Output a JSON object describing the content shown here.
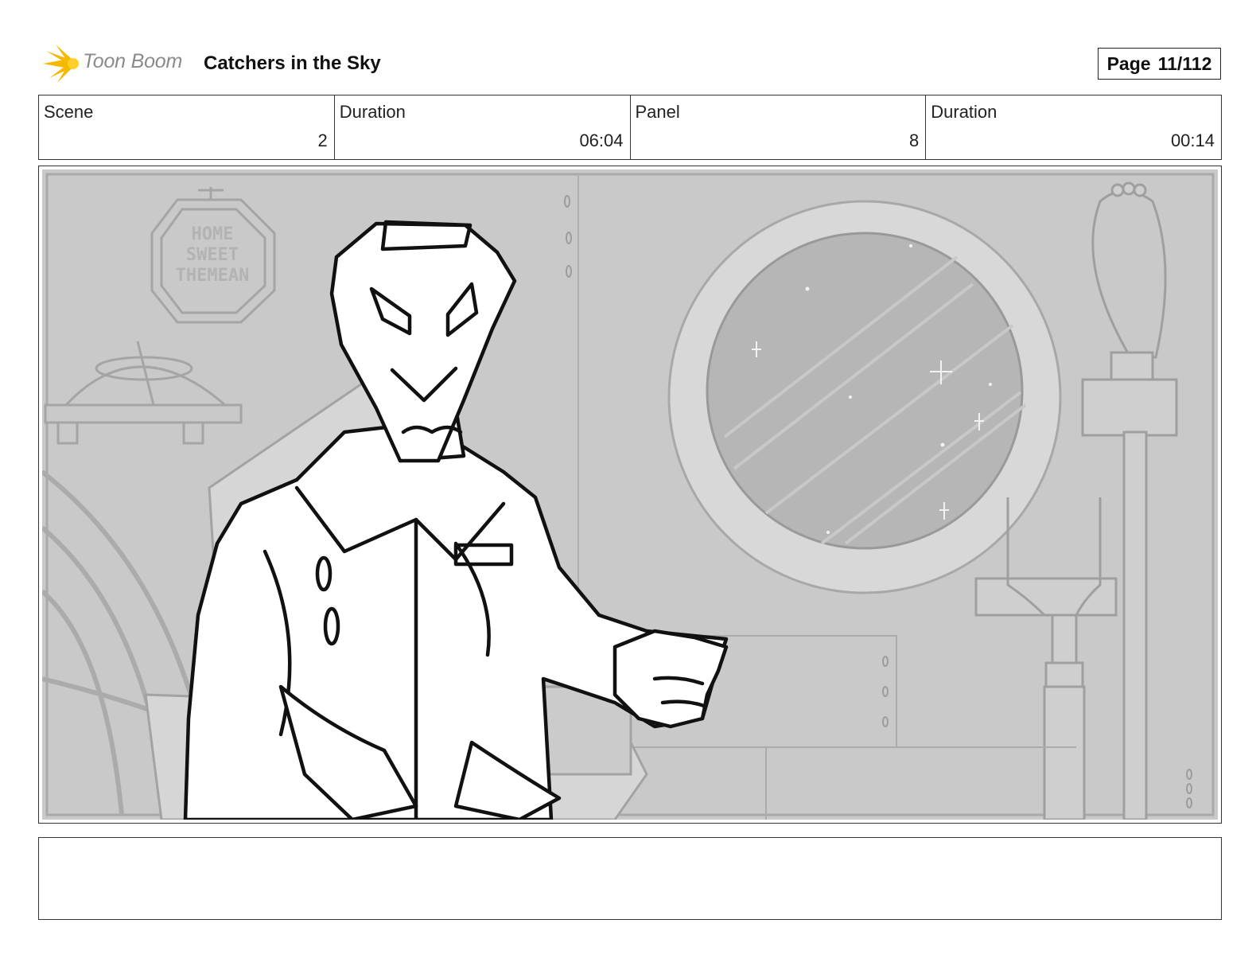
{
  "header": {
    "logo_text": "Toon Boom",
    "logo_icon": "starburst-icon",
    "title": "Catchers in the Sky",
    "page_label": "Page",
    "page_value": "11/112"
  },
  "info": [
    {
      "label": "Scene",
      "value": "2"
    },
    {
      "label": "Duration",
      "value": "06:04"
    },
    {
      "label": "Panel",
      "value": "8"
    },
    {
      "label": "Duration",
      "value": "00:14"
    }
  ],
  "panel": {
    "sign_text": [
      "HOME",
      "SWEET",
      "THEMEAN"
    ]
  },
  "notes": ""
}
